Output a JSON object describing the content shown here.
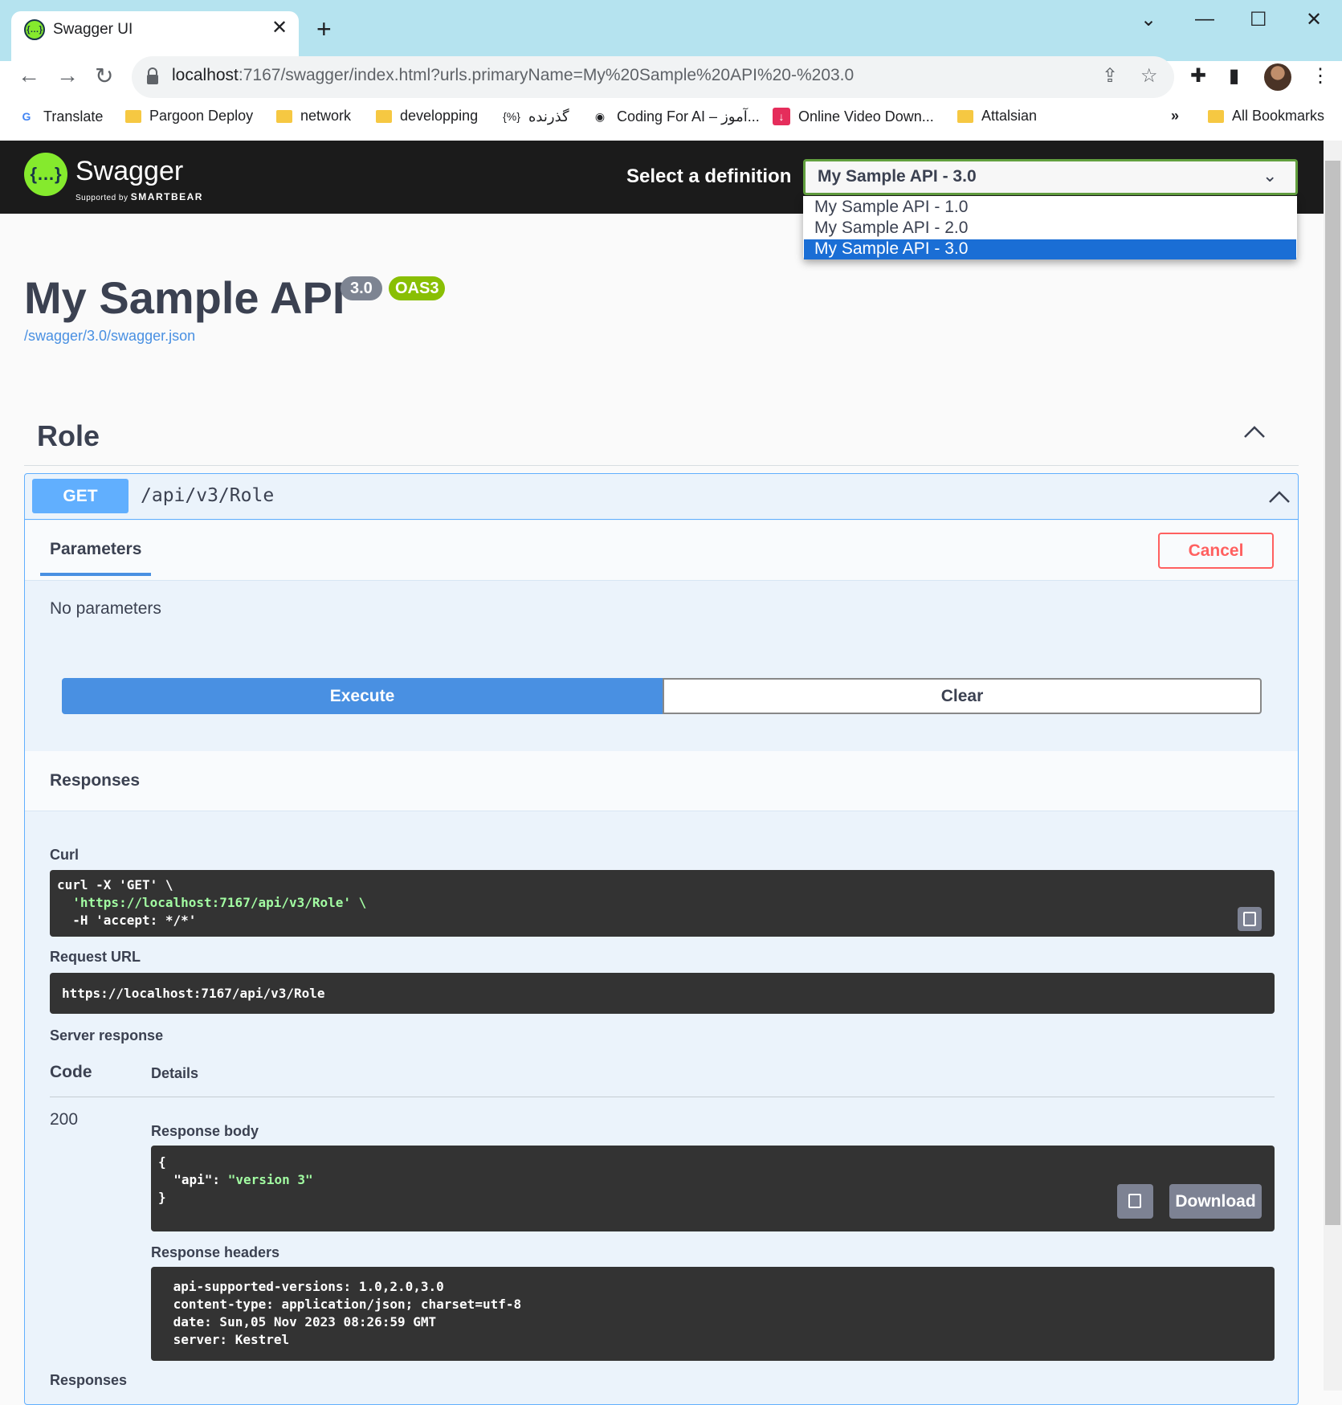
{
  "browser": {
    "tab_title": "Swagger UI",
    "url_host": "localhost",
    "url_rest": ":7167/swagger/index.html?urls.primaryName=My%20Sample%20API%20-%203.0",
    "bookmarks": [
      "Translate",
      "Pargoon Deploy",
      "network",
      "developping",
      "گذرنده",
      "Coding For AI – آموز...",
      "Online Video Down...",
      "Attalsian"
    ],
    "more_bookmarks": "»",
    "all_bookmarks": "All Bookmarks"
  },
  "topbar": {
    "logo_text": "Swagger",
    "logo_sub_prefix": "Supported by",
    "logo_sub_brand": "SMARTBEAR",
    "select_label": "Select a definition",
    "selected": "My Sample API - 3.0",
    "options": [
      "My Sample API - 1.0",
      "My Sample API - 2.0",
      "My Sample API - 3.0"
    ]
  },
  "info": {
    "title": "My Sample API",
    "version": "3.0",
    "oas": "OAS3",
    "link": "/swagger/3.0/swagger.json"
  },
  "tag": {
    "name": "Role"
  },
  "operation": {
    "method": "GET",
    "path": "/api/v3/Role",
    "params_tab": "Parameters",
    "cancel_label": "Cancel",
    "no_params": "No parameters",
    "execute_label": "Execute",
    "clear_label": "Clear",
    "responses_title": "Responses",
    "curl_label": "Curl",
    "curl_lines": [
      "curl -X 'GET' \\",
      "  'https://localhost:7167/api/v3/Role' \\",
      "  -H 'accept: */*'"
    ],
    "request_url_label": "Request URL",
    "request_url": "https://localhost:7167/api/v3/Role",
    "server_response_label": "Server response",
    "code_header": "Code",
    "details_header": "Details",
    "code": "200",
    "response_body_label": "Response body",
    "response_body": [
      "{",
      "  \"api\": \"version 3\"",
      "}"
    ],
    "download_label": "Download",
    "response_headers_label": "Response headers",
    "response_headers": [
      " api-supported-versions: 1.0,2.0,3.0",
      " content-type: application/json; charset=utf-8",
      " date: Sun,05 Nov 2023 08:26:59 GMT",
      " server: Kestrel"
    ],
    "bottom_label": "Responses"
  },
  "colors": {
    "get": "#61affe",
    "execute": "#4990e2",
    "cancel": "#ff6060",
    "oas": "#89bf04",
    "swagger_green": "#85ea2d"
  }
}
